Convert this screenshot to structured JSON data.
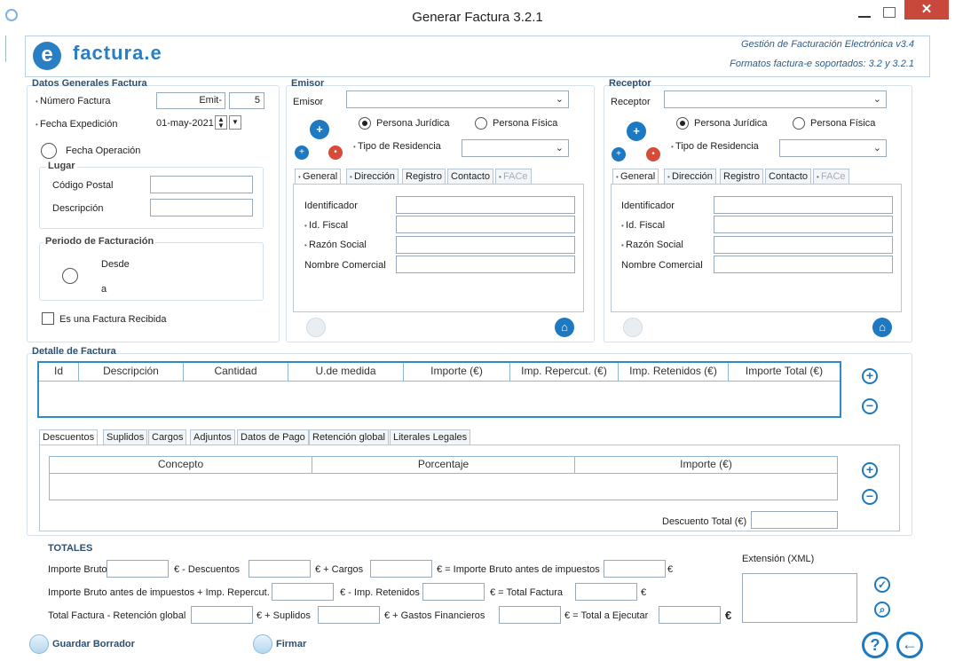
{
  "window": {
    "title": "Generar Factura 3.2.1",
    "close_glyph": "✕"
  },
  "header": {
    "logo_letter": "e",
    "logo_text": "factura.e",
    "version": "Gestión de Facturación Electrónica v3.4",
    "formats": "Formatos factura-e soportados: 3.2 y 3.2.1"
  },
  "datos_generales": {
    "title": "Datos Generales Factura",
    "numero_label": "Número Factura",
    "numero_serie": "Emit-",
    "numero_value": "5",
    "fecha_exp_label": "Fecha Expedición",
    "fecha_exp_value": "01-may-2021",
    "fecha_op_label": "Fecha Operación",
    "lugar_title": "Lugar",
    "cp_label": "Código Postal",
    "desc_label": "Descripción",
    "periodo_title": "Periodo de Facturación",
    "desde_label": "Desde",
    "a_label": "a",
    "recibida_label": "Es una Factura Recibida"
  },
  "emisor": {
    "title": "Emisor",
    "select_label": "Emisor",
    "juridica": "Persona Jurídica",
    "fisica": "Persona Física",
    "residencia_label": "Tipo de Residencia",
    "tabs": [
      "General",
      "Dirección",
      "Registro",
      "Contacto",
      "FACe"
    ],
    "fields": [
      "Identificador",
      "Id. Fiscal",
      "Razón Social",
      "Nombre Comercial"
    ]
  },
  "receptor": {
    "title": "Receptor",
    "select_label": "Receptor",
    "juridica": "Persona Jurídica",
    "fisica": "Persona Física",
    "residencia_label": "Tipo de Residencia",
    "tabs": [
      "General",
      "Dirección",
      "Registro",
      "Contacto",
      "FACe"
    ],
    "fields": [
      "Identificador",
      "Id. Fiscal",
      "Razón Social",
      "Nombre Comercial"
    ]
  },
  "detalle": {
    "title": "Detalle de Factura",
    "columns": [
      "Id",
      "Descripción",
      "Cantidad",
      "U.de medida",
      "Importe (€)",
      "Imp. Repercut. (€)",
      "Imp. Retenidos (€)",
      "Importe Total (€)"
    ]
  },
  "sub_tabs": [
    "Descuentos",
    "Suplidos",
    "Cargos",
    "Adjuntos",
    "Datos de Pago",
    "Retención global",
    "Literales Legales"
  ],
  "descuentos": {
    "columns": [
      "Concepto",
      "Porcentaje",
      "Importe (€)"
    ],
    "total_label": "Descuento Total (€)"
  },
  "totales": {
    "title": "TOTALES",
    "row1": [
      "Importe Bruto",
      "€ - Descuentos",
      "€ + Cargos",
      "€ = Importe Bruto antes de impuestos",
      "€"
    ],
    "row2": [
      "Importe Bruto antes de impuestos + Imp. Repercut.",
      "€ - Imp. Retenidos",
      "€ = Total Factura",
      "€"
    ],
    "row3": [
      "Total Factura - Retención global",
      "€ + Suplidos",
      "€ + Gastos Financieros",
      "€ = Total a Ejecutar",
      "€"
    ],
    "extension_label": "Extensión (XML)"
  },
  "footer": {
    "guardar": "Guardar Borrador",
    "firmar": "Firmar",
    "help": "?",
    "back": "←"
  },
  "icons": {
    "plus": "+",
    "minus": "−",
    "check": "✓",
    "search": "⌕"
  }
}
